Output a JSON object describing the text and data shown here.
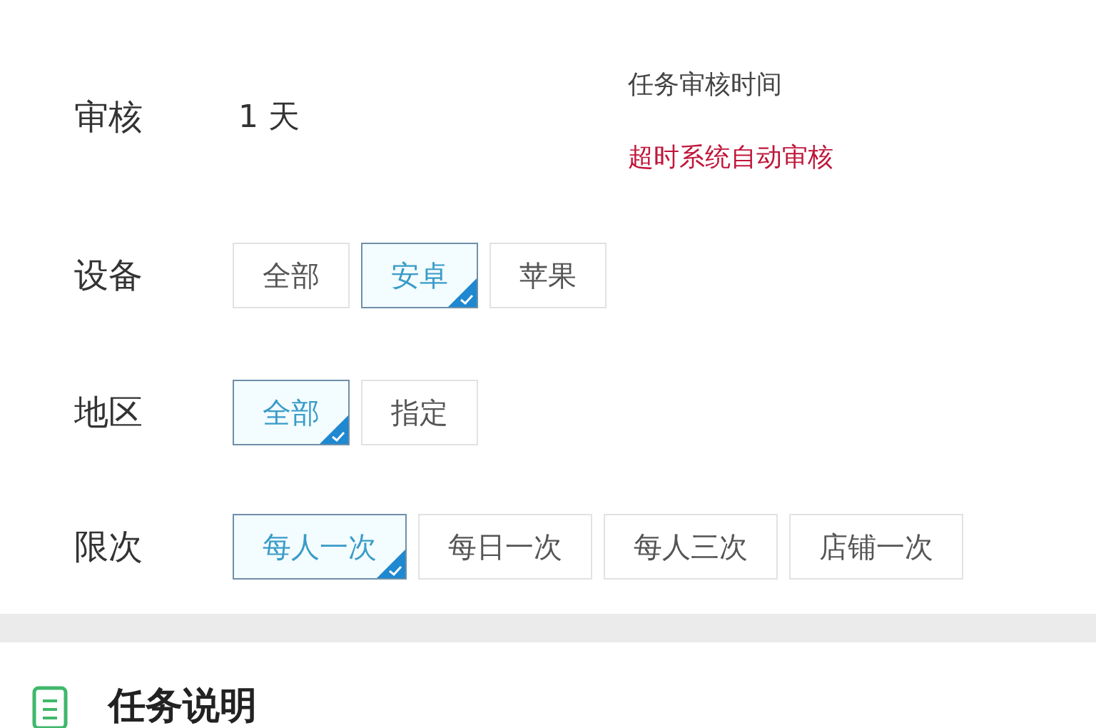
{
  "review": {
    "label": "审核",
    "value": "1 天",
    "note_title": "任务审核时间",
    "note_warning": "超时系统自动审核"
  },
  "filters": [
    {
      "label": "设备",
      "options": [
        {
          "text": "全部",
          "selected": false
        },
        {
          "text": "安卓",
          "selected": true
        },
        {
          "text": "苹果",
          "selected": false
        }
      ]
    },
    {
      "label": "地区",
      "options": [
        {
          "text": "全部",
          "selected": true
        },
        {
          "text": "指定",
          "selected": false
        }
      ]
    },
    {
      "label": "限次",
      "options": [
        {
          "text": "每人一次",
          "selected": true
        },
        {
          "text": "每日一次",
          "selected": false
        },
        {
          "text": "每人三次",
          "selected": false
        },
        {
          "text": "店铺一次",
          "selected": false
        }
      ]
    }
  ],
  "section": {
    "title": "任务说明"
  }
}
